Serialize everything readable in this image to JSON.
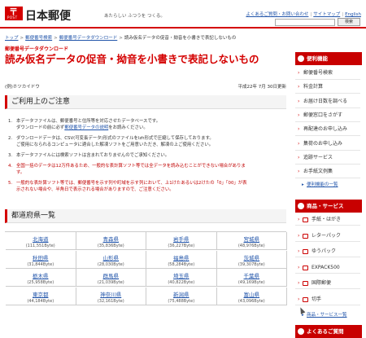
{
  "header": {
    "logo_mark": "〒",
    "logo_text": "POST",
    "brand": "日本郵便",
    "tagline": "あたらしい ふつうを つくる。",
    "toplinks": [
      "よくあるご質問・お問い合わせ",
      "サイトマップ",
      "English"
    ],
    "search_placeholder": "",
    "search_button": "検索"
  },
  "breadcrumb": [
    "トップ",
    "郵便番号検索",
    "郵便番号データダウンロード",
    "読み仮名データの促音・拗音を小書きで表記しないもの"
  ],
  "page": {
    "category": "郵便番号データダウンロード",
    "title": "読み仮名データの促音・拗音を小書きで表記しないもの",
    "kana_note": "(例)ホツカイドウ",
    "date": "平成22年 7月 30日更新"
  },
  "notice": {
    "heading": "ご利用上のご注意",
    "items": [
      {
        "num": "1.",
        "lines": [
          "本データファイルは、郵便番号と住所等を対応させたデータベースです。",
          "ダウンロードの前に必ず"
        ],
        "link": "郵便番号データの説明",
        "tail": "をお読みください。"
      },
      {
        "num": "2.",
        "lines": [
          "ダウンロードデータは、CSV(可変長データ)形式のファイルをlzh形式で圧縮して保存しております。",
          "ご使用になられるコンピュータに適合した解凍ソフトをご用意いただき、解凍の上ご使用ください。"
        ]
      },
      {
        "num": "3.",
        "lines": [
          "本データファイルには検索ソフトは含まれておりませんのでご承知ください。"
        ]
      },
      {
        "num": "4.",
        "lines": [
          "全国一括のデータは12万件あるため、一般的な表計算ソフト等では全データを読み込むことができない場合がありま",
          "す。"
        ],
        "red": true
      },
      {
        "num": "5.",
        "lines": [
          "一般的な表計算ソフト等では、郵便番号を示す列や町域を示す列において、上1けたあるいは2けたの「0」「00」が表",
          "示されない場合や、半角日で表示される場合がありますので、ご注意ください。"
        ],
        "red": true
      }
    ]
  },
  "prefectures": {
    "heading": "都道府県一覧",
    "items": [
      {
        "name": "北海道",
        "size": "(111,551Byte)"
      },
      {
        "name": "青森県",
        "size": "(35,836Byte)"
      },
      {
        "name": "岩手県",
        "size": "(36,227Byte)"
      },
      {
        "name": "宮城県",
        "size": "(48,976Byte)"
      },
      {
        "name": "秋田県",
        "size": "(31,844Byte)"
      },
      {
        "name": "山形県",
        "size": "(28,030Byte)"
      },
      {
        "name": "福島県",
        "size": "(58,284Byte)"
      },
      {
        "name": "茨城県",
        "size": "(39,307Byte)"
      },
      {
        "name": "栃木県",
        "size": "(25,958Byte)"
      },
      {
        "name": "群馬県",
        "size": "(21,039Byte)"
      },
      {
        "name": "埼玉県",
        "size": "(40,822Byte)"
      },
      {
        "name": "千葉県",
        "size": "(49,169Byte)"
      },
      {
        "name": "東京都",
        "size": "(44,184Byte)"
      },
      {
        "name": "神奈川県",
        "size": "(32,161Byte)"
      },
      {
        "name": "新潟県",
        "size": "(75,488Byte)"
      },
      {
        "name": "富山県",
        "size": "(43,096Byte)"
      }
    ]
  },
  "sidebar": {
    "convenience_heading": "便利機能",
    "convenience_items": [
      "郵便番号検索",
      "料金計算",
      "お届け日数を調べる",
      "郵便窓口をさがす",
      "再配達のお申し込み",
      "集荷のお申し込み",
      "追跡サービス",
      "お手紙文例集"
    ],
    "convenience_more": "便利機能の一覧",
    "services_heading": "商品・サービス",
    "services_items": [
      "手紙・はがき",
      "レターパック",
      "ゆうパック",
      "EXPACK500",
      "国際郵便",
      "切手"
    ],
    "services_more": "商品・サービス一覧",
    "faq_heading": "よくあるご質問"
  }
}
